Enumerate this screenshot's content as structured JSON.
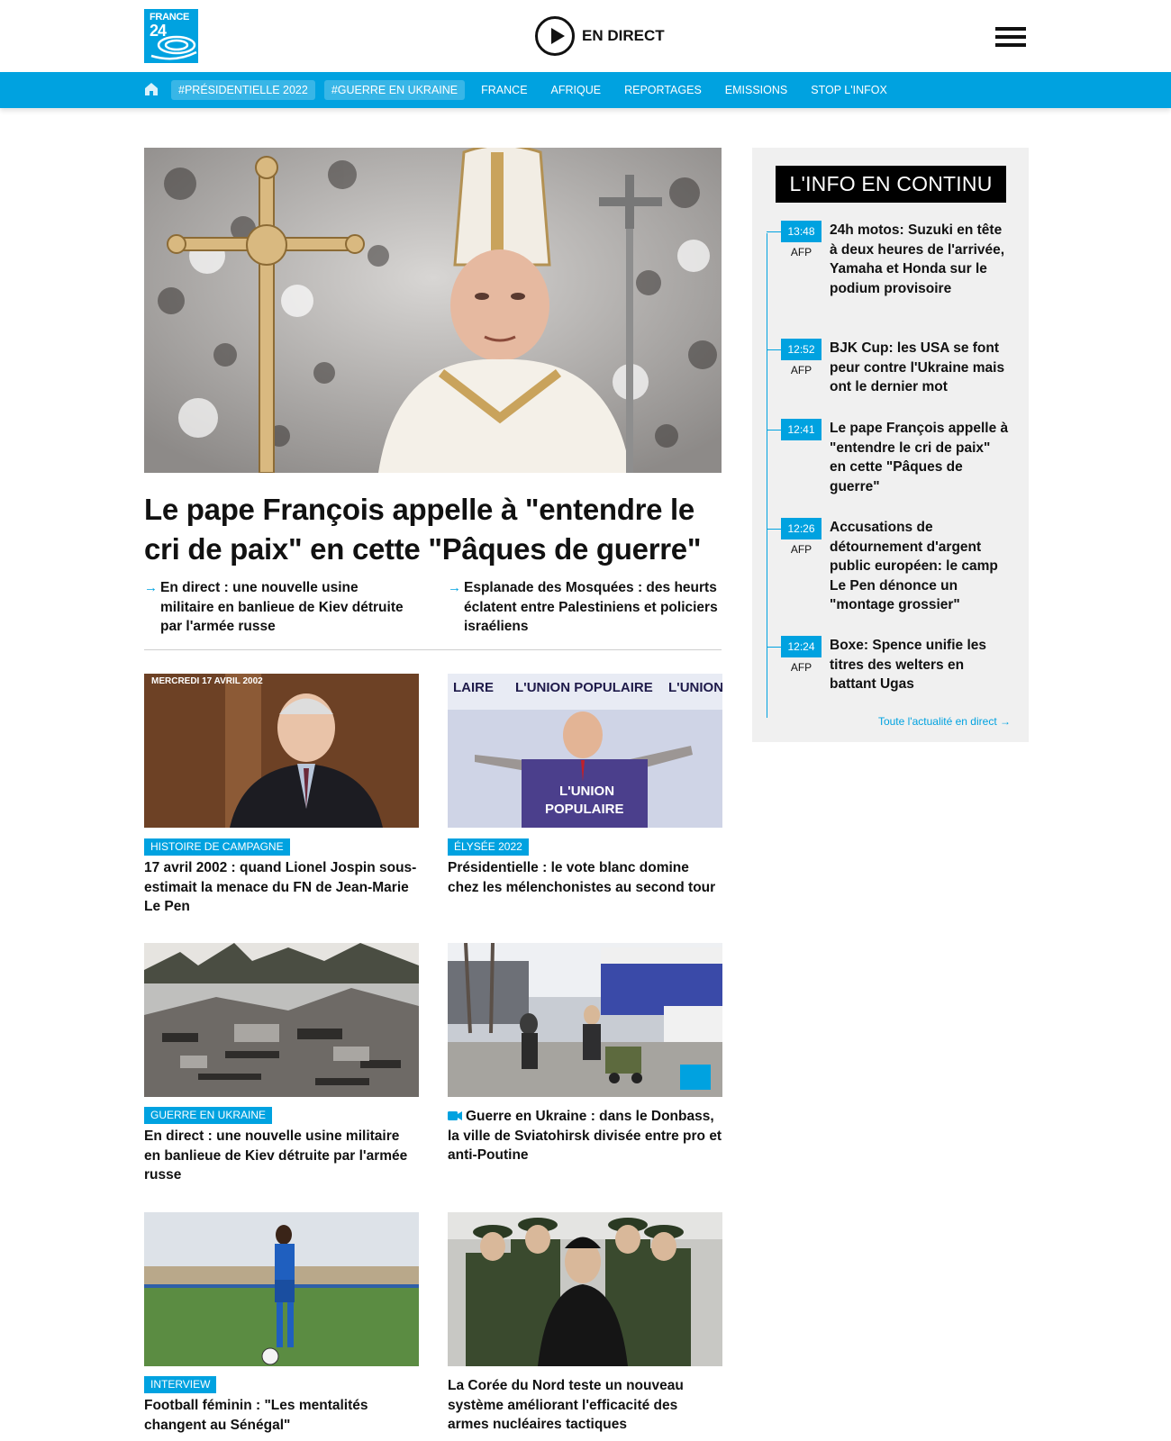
{
  "header": {
    "logo_line1": "FRANCE",
    "logo_line2": "24",
    "live_label": "EN DIRECT"
  },
  "nav": {
    "items": [
      {
        "label": "#PRÉSIDENTIELLE 2022"
      },
      {
        "label": "#GUERRE EN UKRAINE"
      },
      {
        "label": "FRANCE"
      },
      {
        "label": "AFRIQUE"
      },
      {
        "label": "REPORTAGES"
      },
      {
        "label": "EMISSIONS"
      },
      {
        "label": "STOP L'INFOX"
      }
    ]
  },
  "hero": {
    "title": "Le pape François appelle à \"entendre le cri de paix\" en cette \"Pâques de guerre\"",
    "related": [
      {
        "text": "En direct : une nouvelle usine militaire en banlieue de Kiev détruite par l'armée russe"
      },
      {
        "text": "Esplanade des Mosquées : des heurts éclatent entre Palestiniens et policiers israéliens"
      }
    ]
  },
  "cards": [
    {
      "tag": "HISTOIRE DE CAMPAGNE",
      "title": "17 avril 2002 : quand Lionel Jospin sous-estimait la menace du FN de Jean-Marie Le Pen",
      "img_caption": "MERCREDI 17 AVRIL 2002"
    },
    {
      "tag": "ÉLYSÉE 2022",
      "title": "Présidentielle : le vote blanc domine chez les mélenchonistes au second tour",
      "img_caption": "L'UNION POPULAIRE"
    },
    {
      "tag": "GUERRE EN UKRAINE",
      "title": "En direct : une nouvelle usine militaire en banlieue de Kiev détruite par l'armée russe"
    },
    {
      "tag": "",
      "title": "Guerre en Ukraine : dans le Donbass, la ville de Sviatohirsk divisée entre pro et anti-Poutine"
    },
    {
      "tag": "INTERVIEW",
      "title": "Football féminin : \"Les mentalités changent au Sénégal\""
    },
    {
      "tag": "",
      "title": "La Corée du Nord teste un nouveau système améliorant l'efficacité des armes nucléaires tactiques"
    }
  ],
  "sidebar": {
    "title": "L'INFO EN CONTINU",
    "items": [
      {
        "time": "13:48",
        "source": "AFP",
        "title": "24h motos: Suzuki en tête à deux heures de l'arrivée, Yamaha et Honda sur le podium provisoire"
      },
      {
        "time": "12:52",
        "source": "AFP",
        "title": "BJK Cup: les USA se font peur contre l'Ukraine mais ont le dernier mot"
      },
      {
        "time": "12:41",
        "source": "",
        "title": "Le pape François appelle à \"entendre le cri de paix\" en cette \"Pâques de guerre\""
      },
      {
        "time": "12:26",
        "source": "AFP",
        "title": "Accusations de détournement d'argent public européen: le camp Le Pen dénonce un \"montage grossier\""
      },
      {
        "time": "12:24",
        "source": "AFP",
        "title": "Boxe: Spence unifie les titres des welters en battant Ugas"
      }
    ],
    "more_link": "Toute l'actualité en direct →"
  },
  "colors": {
    "brand": "#00a2e0",
    "text": "#111111",
    "sidebar_bg": "#f0f0f0"
  }
}
